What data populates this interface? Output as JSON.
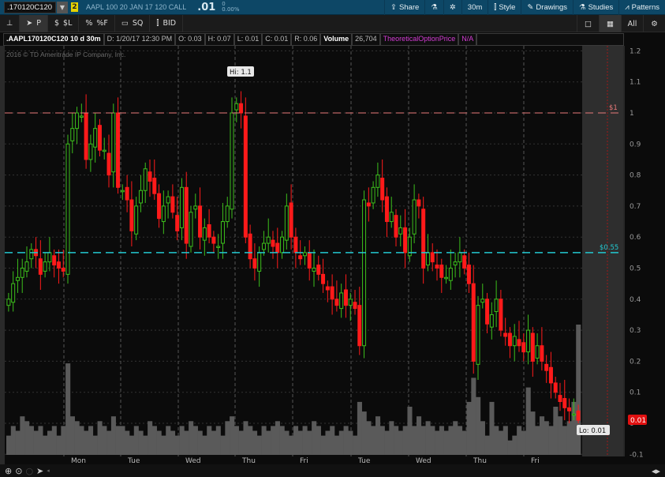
{
  "header": {
    "symbol": ".170120C120",
    "link_badge": "2",
    "description": "AAPL 100 20 JAN 17 120 CALL",
    "last": ".01",
    "change": "0",
    "change_pct": "0.00%",
    "buttons": [
      {
        "label": "Share",
        "icon": "share-icon"
      },
      {
        "label": "",
        "icon": "flask-icon"
      },
      {
        "label": "",
        "icon": "gear-icon"
      },
      {
        "label": "30m",
        "icon": ""
      },
      {
        "label": "Style",
        "icon": "candle-icon"
      },
      {
        "label": "Drawings",
        "icon": "pencil-icon"
      },
      {
        "label": "Studies",
        "icon": "flask-icon"
      },
      {
        "label": "Patterns",
        "icon": "patterns-icon"
      }
    ]
  },
  "toolbar": {
    "items": [
      {
        "label": "",
        "icon": "pin-icon"
      },
      {
        "label": "P",
        "icon": "pointer-icon"
      },
      {
        "label": "$L",
        "icon": "dollar-icon"
      },
      {
        "label": "%F",
        "icon": "percent-icon"
      },
      {
        "label": "SQ",
        "icon": "square-icon"
      },
      {
        "label": "BID",
        "icon": "candle-icon"
      }
    ],
    "right": [
      {
        "label": "□",
        "icon": "single-layout-icon"
      },
      {
        "label": "▦",
        "icon": "grid-layout-icon"
      },
      {
        "label": "All",
        "icon": "all-icon"
      },
      {
        "label": "⚙",
        "icon": "gear-icon"
      }
    ]
  },
  "info": {
    "name": ".AAPL170120C120 10 d 30m",
    "date": "D: 1/20/17 12:30 PM",
    "open": "O: 0.03",
    "high": "H: 0.07",
    "low": "L: 0.01",
    "close": "C: 0.01",
    "range": "R: 0.06",
    "volume_label": "Volume",
    "volume": "26,704",
    "study": "TheoreticalOptionPrice",
    "study_value": "N/A"
  },
  "copyright": "2016 © TD Ameritrade IP Company, Inc.",
  "colors": {
    "up": "#3cbf1c",
    "down": "#ff1a1a",
    "resistance": "#e87a7a",
    "support": "#23c8d0",
    "volume": "#5a5a5a"
  },
  "chart_data": {
    "type": "candlestick",
    "y_ticks": [
      "1.2",
      "1.1",
      "1",
      "0.9",
      "0.8",
      "0.7",
      "0.6",
      "0.5",
      "0.4",
      "0.3",
      "0.2",
      "0.1",
      "0",
      "-0.1"
    ],
    "ylim": [
      -0.1,
      1.2
    ],
    "days": [
      "Mon",
      "Tue",
      "Wed",
      "Thu",
      "Fri",
      "Tue",
      "Wed",
      "Thu",
      "Fri"
    ],
    "hi_label": "Hi: 1.1",
    "lo_label": "Lo: 0.01",
    "last_badge": "0.01",
    "lines": [
      {
        "price": 1.0,
        "label": "$1"
      },
      {
        "price": 0.55,
        "label": "$0.55"
      }
    ],
    "closes": [
      0.4,
      0.45,
      0.47,
      0.5,
      0.52,
      0.56,
      0.54,
      0.48,
      0.52,
      0.55,
      0.51,
      0.5,
      0.49,
      0.9,
      0.95,
      1.0,
      0.99,
      0.85,
      0.9,
      0.95,
      0.88,
      0.88,
      0.8,
      1.0,
      0.76,
      0.75,
      0.72,
      0.62,
      0.7,
      0.75,
      0.82,
      0.78,
      0.74,
      0.66,
      0.7,
      0.73,
      0.68,
      0.62,
      0.76,
      0.58,
      0.68,
      0.7,
      0.6,
      0.63,
      0.6,
      0.58,
      0.57,
      0.65,
      0.7,
      1.0,
      1.03,
      1.0,
      0.6,
      0.53,
      0.5,
      0.55,
      0.58,
      0.6,
      0.57,
      0.55,
      0.6,
      0.7,
      0.6,
      0.55,
      0.53,
      0.55,
      0.5,
      0.5,
      0.48,
      0.45,
      0.43,
      0.4,
      0.38,
      0.42,
      0.38,
      0.4,
      0.37,
      0.25,
      0.72,
      0.7,
      0.76,
      0.8,
      0.72,
      0.65,
      0.68,
      0.6,
      0.63,
      0.55,
      0.6,
      0.72,
      0.7,
      0.5,
      0.55,
      0.52,
      0.5,
      0.47,
      0.47,
      0.5,
      0.52,
      0.55,
      0.5,
      0.45,
      0.2,
      0.38,
      0.4,
      0.32,
      0.35,
      0.4,
      0.3,
      0.28,
      0.25,
      0.28,
      0.25,
      0.23,
      0.3,
      0.2,
      0.25,
      0.2,
      0.17,
      0.13,
      0.1,
      0.07,
      0.05,
      0.04,
      0.03,
      0.01
    ],
    "volume_rel": [
      0.2,
      0.3,
      0.25,
      0.4,
      0.35,
      0.3,
      0.25,
      0.3,
      0.2,
      0.25,
      0.3,
      0.2,
      0.3,
      0.95,
      0.4,
      0.35,
      0.3,
      0.25,
      0.3,
      0.2,
      0.35,
      0.3,
      0.25,
      0.4,
      0.3,
      0.3,
      0.25,
      0.2,
      0.3,
      0.25,
      0.2,
      0.35,
      0.3,
      0.25,
      0.2,
      0.3,
      0.25,
      0.2,
      0.3,
      0.25,
      0.35,
      0.3,
      0.25,
      0.2,
      0.3,
      0.25,
      0.3,
      0.2,
      0.35,
      0.4,
      0.3,
      0.25,
      0.35,
      0.3,
      0.25,
      0.2,
      0.3,
      0.25,
      0.3,
      0.35,
      0.3,
      0.25,
      0.2,
      0.3,
      0.25,
      0.3,
      0.25,
      0.35,
      0.3,
      0.2,
      0.25,
      0.3,
      0.2,
      0.25,
      0.3,
      0.25,
      0.2,
      0.55,
      0.45,
      0.35,
      0.3,
      0.4,
      0.3,
      0.25,
      0.35,
      0.3,
      0.25,
      0.3,
      0.5,
      0.3,
      0.4,
      0.3,
      0.35,
      0.3,
      0.25,
      0.3,
      0.25,
      0.3,
      0.35,
      0.3,
      0.25,
      0.55,
      0.8,
      0.6,
      0.35,
      0.2,
      0.55,
      0.3,
      0.25,
      0.3,
      0.15,
      0.2,
      0.3,
      0.25,
      0.7,
      0.45,
      0.3,
      0.4,
      0.35,
      0.3,
      0.5,
      0.4,
      0.3,
      0.35,
      0.55,
      1.75
    ]
  }
}
